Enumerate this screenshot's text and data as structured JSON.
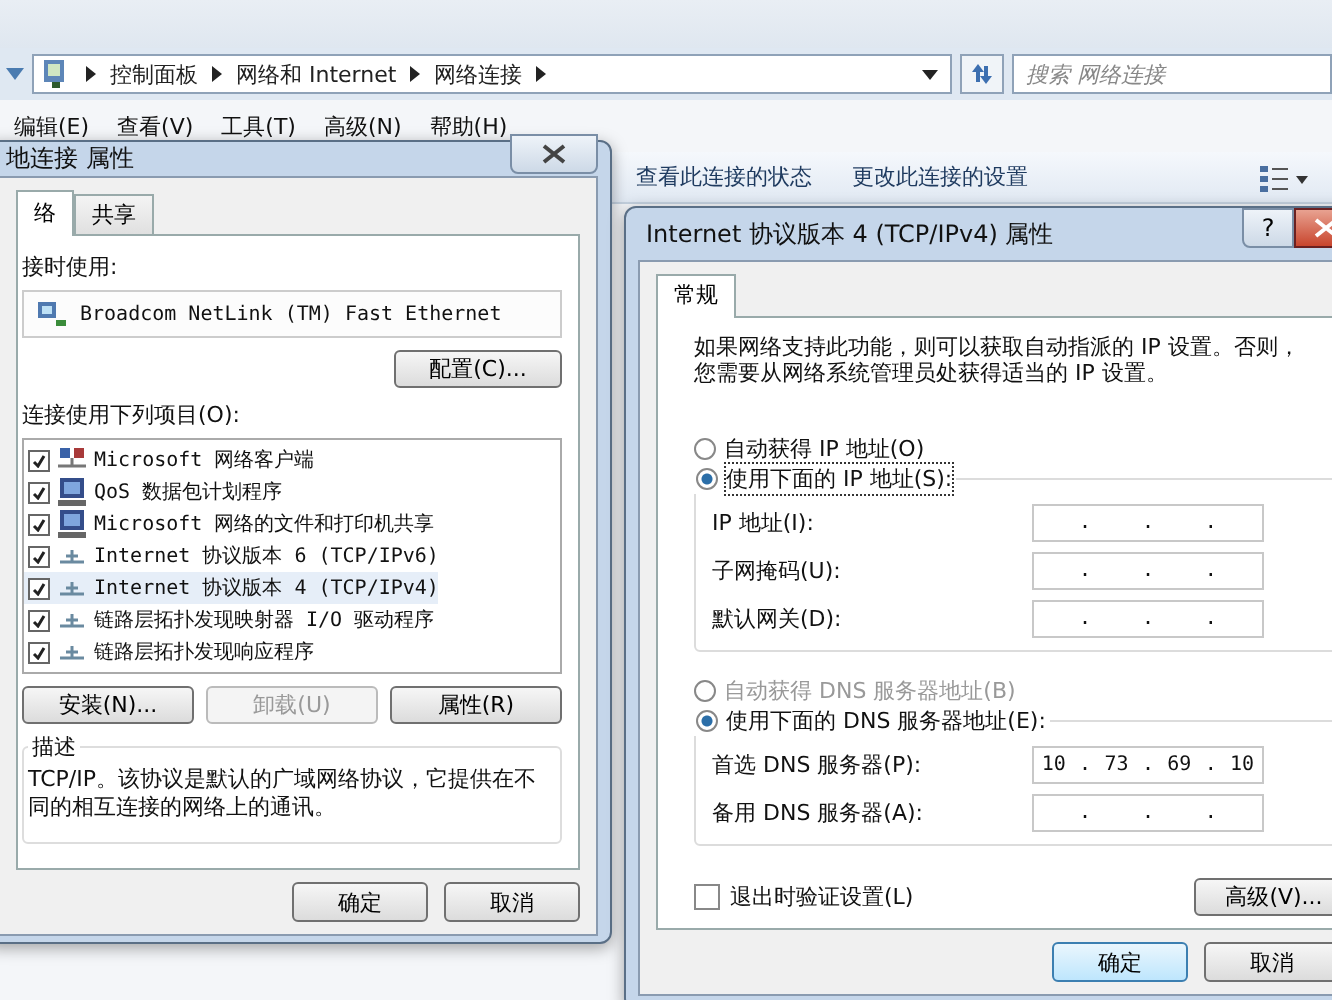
{
  "address_bar": {
    "breadcrumb": [
      "控制面板",
      "网络和 Internet",
      "网络连接"
    ]
  },
  "search": {
    "placeholder": "搜索 网络连接"
  },
  "menu_bar": [
    "编辑(E)",
    "查看(V)",
    "工具(T)",
    "高级(N)",
    "帮助(H)"
  ],
  "toolbar": [
    "查看此连接的状态",
    "更改此连接的设置"
  ],
  "connection_dialog": {
    "title": "地连接 属性",
    "tabs": [
      {
        "label": "络",
        "selected": true
      },
      {
        "label": "共享",
        "selected": false
      }
    ],
    "connect_using_label": "接时使用:",
    "adapter": "Broadcom NetLink (TM) Fast Ethernet",
    "configure_button": "配置(C)...",
    "items_label": "连接使用下列项目(O):",
    "items": [
      {
        "name": "Microsoft 网络客户端",
        "kind": "client",
        "checked": true,
        "selected": false
      },
      {
        "name": "QoS 数据包计划程序",
        "kind": "service",
        "checked": true,
        "selected": false
      },
      {
        "name": "Microsoft 网络的文件和打印机共享",
        "kind": "service",
        "checked": true,
        "selected": false
      },
      {
        "name": "Internet 协议版本 6 (TCP/IPv6)",
        "kind": "protocol",
        "checked": true,
        "selected": false
      },
      {
        "name": "Internet 协议版本 4 (TCP/IPv4)",
        "kind": "protocol",
        "checked": true,
        "selected": true
      },
      {
        "name": "链路层拓扑发现映射器 I/O 驱动程序",
        "kind": "protocol",
        "checked": true,
        "selected": false
      },
      {
        "name": "链路层拓扑发现响应程序",
        "kind": "protocol",
        "checked": true,
        "selected": false
      }
    ],
    "item_buttons": [
      {
        "label": "安装(N)...",
        "disabled": false
      },
      {
        "label": "卸载(U)",
        "disabled": true
      },
      {
        "label": "属性(R)",
        "disabled": false
      }
    ],
    "description_title": "描述",
    "description": "TCP/IP。该协议是默认的广域网络协议，它提供在不同的相互连接的网络上的通讯。",
    "buttons": [
      "确定",
      "取消"
    ]
  },
  "ipv4_dialog": {
    "title": "Internet 协议版本 4 (TCP/IPv4) 属性",
    "help_button": "?",
    "tabs": [
      {
        "label": "常规",
        "selected": true
      }
    ],
    "intro": "如果网络支持此功能，则可以获取自动指派的 IP 设置。否则，您需要从网络系统管理员处获得适当的 IP 设置。",
    "ip_options": [
      {
        "label": "自动获得 IP 地址(O)",
        "selected": false,
        "disabled": false,
        "focused": false
      },
      {
        "label": "使用下面的 IP 地址(S):",
        "selected": true,
        "disabled": false,
        "focused": true
      }
    ],
    "ip_fields": [
      {
        "label": "IP 地址(I):",
        "separators": [
          ".",
          ".",
          "."
        ]
      },
      {
        "label": "子网掩码(U):",
        "separators": [
          ".",
          ".",
          "."
        ]
      },
      {
        "label": "默认网关(D):",
        "separators": [
          ".",
          ".",
          "."
        ]
      }
    ],
    "dns_options": [
      {
        "label": "自动获得 DNS 服务器地址(B)",
        "selected": false,
        "disabled": true,
        "focused": false
      },
      {
        "label": "使用下面的 DNS 服务器地址(E):",
        "selected": true,
        "disabled": false,
        "focused": false
      }
    ],
    "dns_fields": [
      {
        "label": "首选 DNS 服务器(P):",
        "separators": [
          ".",
          ".",
          "."
        ],
        "octets": [
          "10",
          "73",
          "69",
          "10"
        ]
      },
      {
        "label": "备用 DNS 服务器(A):",
        "separators": [
          ".",
          ".",
          "."
        ]
      }
    ],
    "validate": {
      "label": "退出时验证设置(L)",
      "checked": false
    },
    "advanced_button": "高级(V)...",
    "buttons": [
      {
        "label": "确定",
        "default": true
      },
      {
        "label": "取消",
        "default": false
      }
    ]
  }
}
